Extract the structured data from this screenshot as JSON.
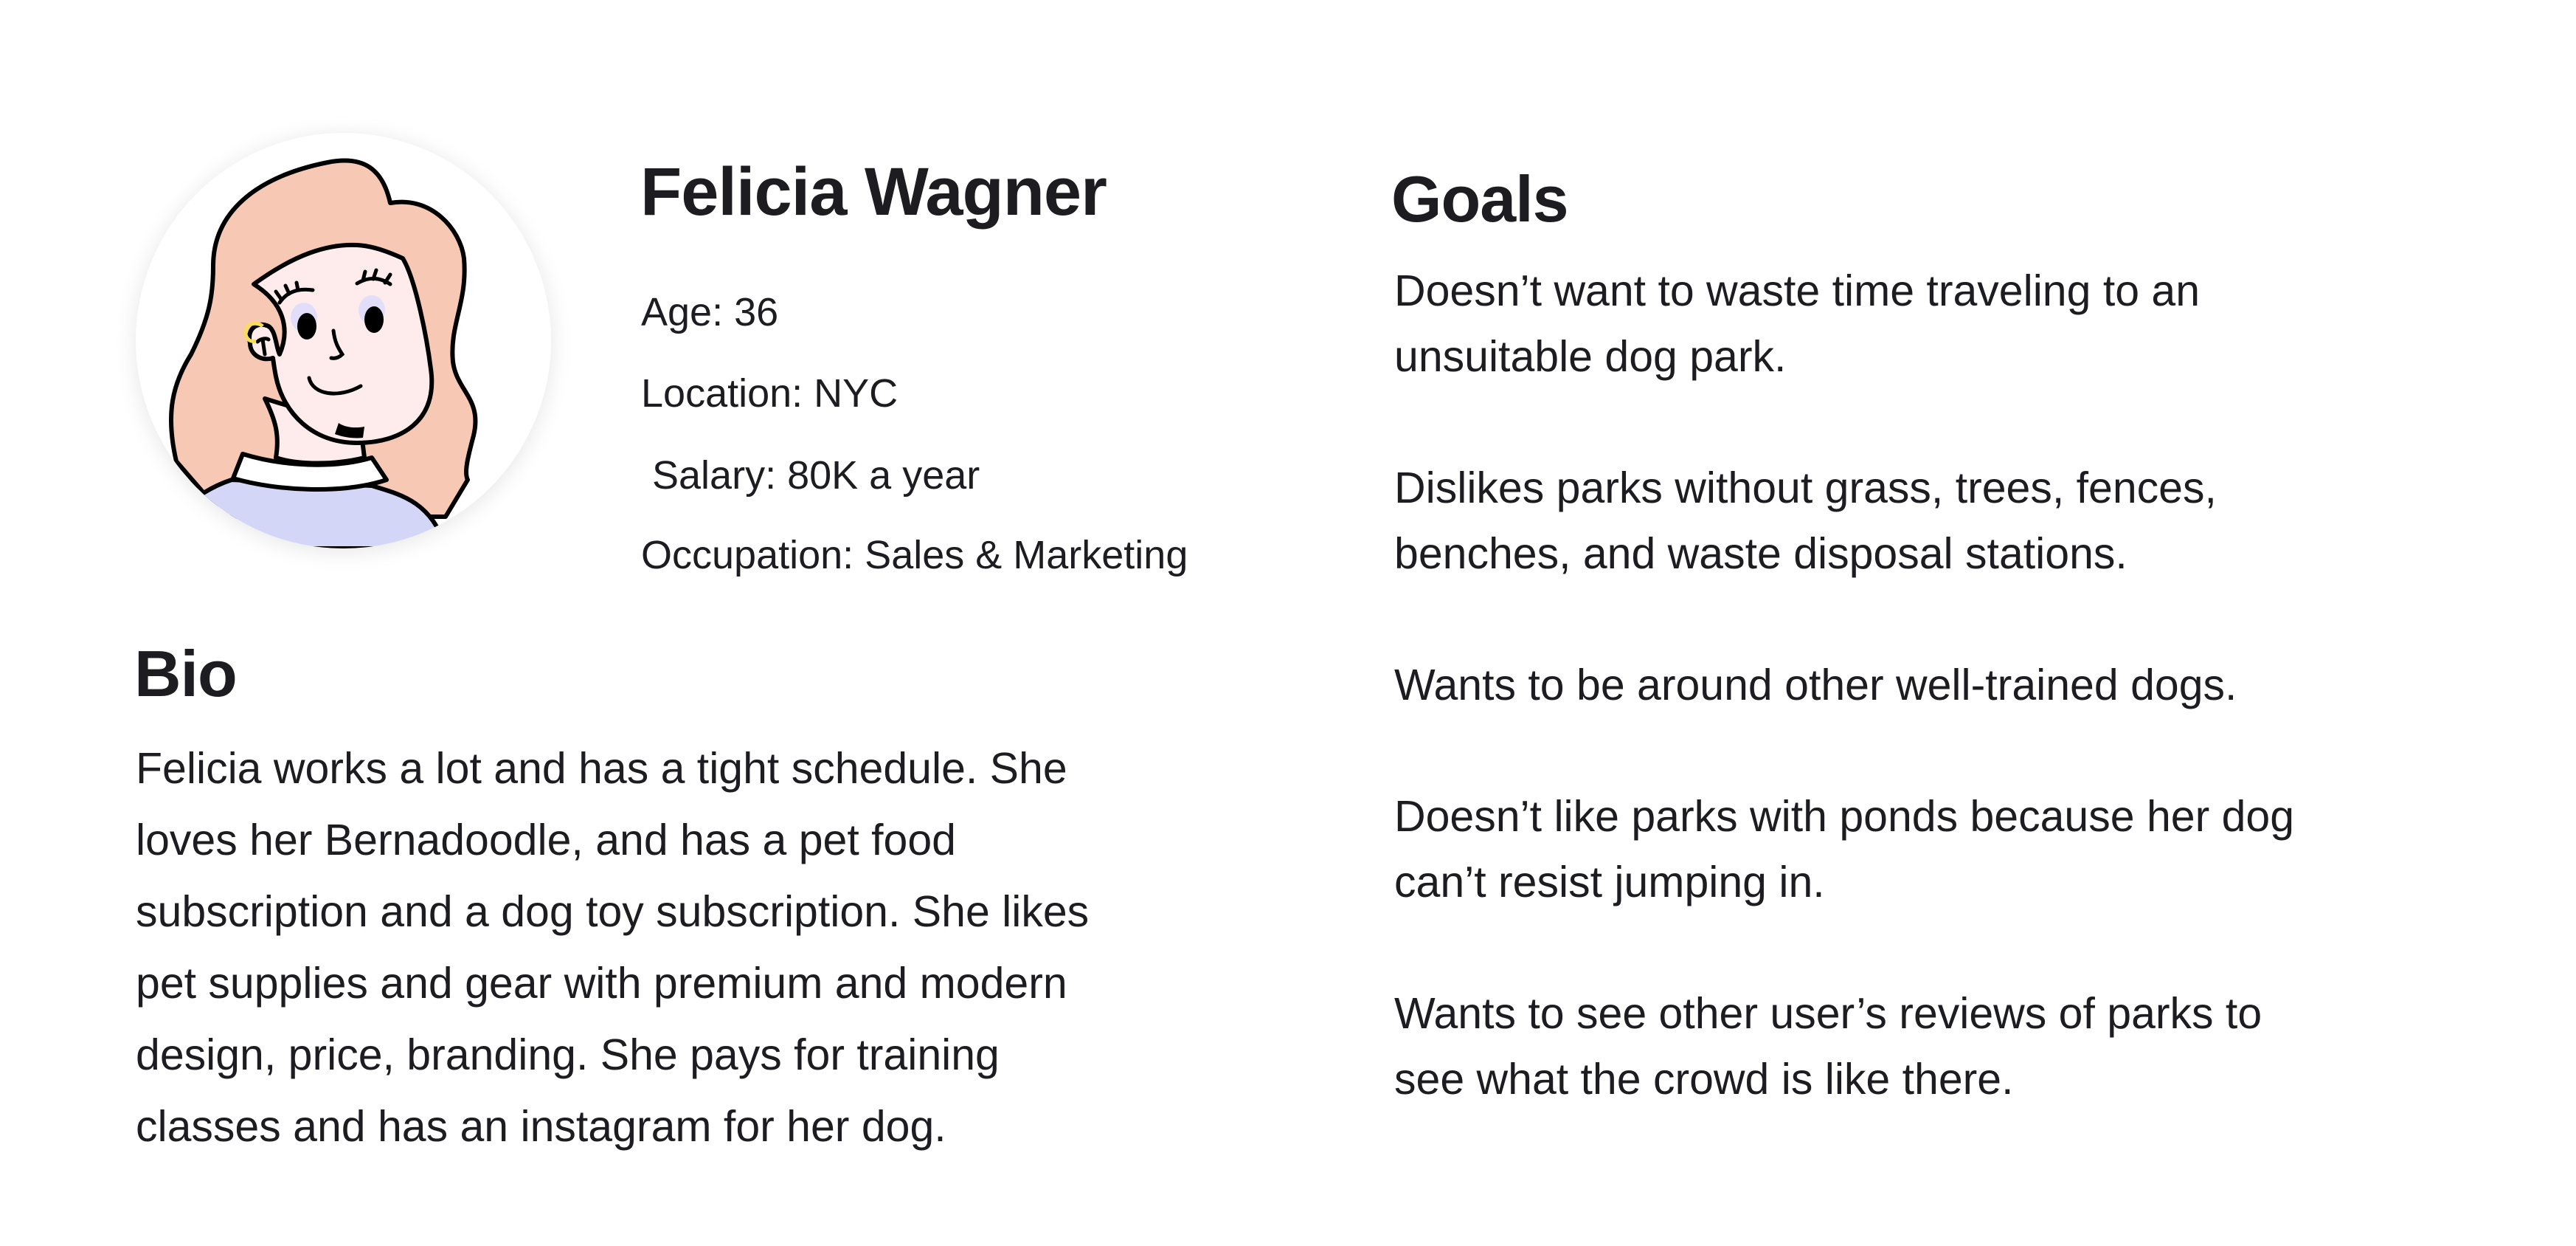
{
  "persona": {
    "name": "Felicia Wagner",
    "details": {
      "age": "Age: 36",
      "location": "Location: NYC",
      "salary": " Salary: 80K a year",
      "occupation": "Occupation: Sales & Marketing"
    }
  },
  "bio": {
    "heading": "Bio",
    "lines": [
      "Felicia works a lot and has a tight schedule. She",
      "loves her Bernadoodle, and has a pet food",
      "subscription and a dog toy subscription. She likes",
      "pet supplies and gear with premium and modern",
      "design, price, branding. She pays for training",
      "classes and has an instagram for her dog."
    ]
  },
  "goals": {
    "heading": "Goals",
    "items": [
      [
        "Doesn’t want to waste time traveling to an",
        "unsuitable dog park."
      ],
      [
        "Dislikes parks without grass, trees, fences,",
        "benches, and waste disposal stations."
      ],
      [
        "Wants to be around other well-trained dogs."
      ],
      [
        "Doesn’t like parks with ponds because her dog",
        "can’t resist jumping in."
      ],
      [
        "Wants to see other user’s reviews of parks to",
        "see what the crowd is like there."
      ]
    ]
  },
  "colors": {
    "text": "#1c1c21",
    "hair": "#f7c8b3",
    "skin": "#feeced",
    "shirt": "#d3d6f6",
    "earring": "#f9dd5a"
  }
}
